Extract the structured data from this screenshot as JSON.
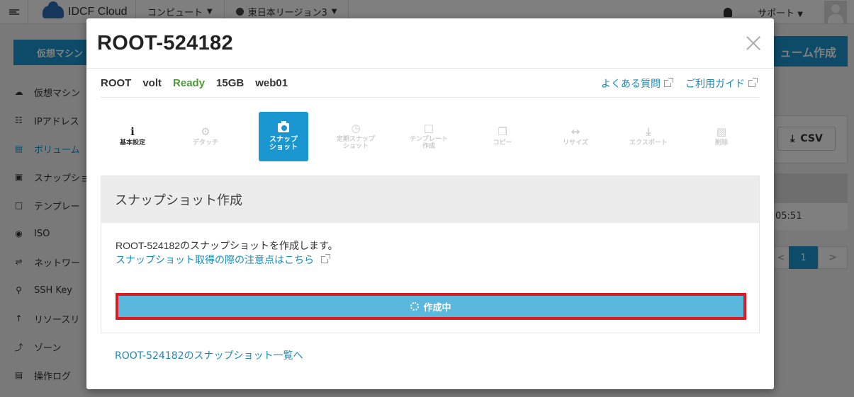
{
  "topbar": {
    "logo": "IDCF Cloud",
    "nav": [
      "コンピュート",
      "東日本リージョン3"
    ],
    "support": "サポート"
  },
  "sidebar": {
    "vm_button": "仮想マシン",
    "items": [
      {
        "label": "仮想マシン",
        "icon": "cloud-icon"
      },
      {
        "label": "IPアドレス",
        "icon": "network-icon"
      },
      {
        "label": "ボリューム",
        "icon": "database-icon",
        "active": true
      },
      {
        "label": "スナップショ",
        "icon": "camera-icon"
      },
      {
        "label": "テンプレー",
        "icon": "file-icon"
      },
      {
        "label": "ISO",
        "icon": "disc-icon"
      },
      {
        "label": "ネットワー",
        "icon": "shuffle-icon"
      },
      {
        "label": "SSH Key",
        "icon": "key-icon"
      },
      {
        "label": "リソースリ",
        "icon": "level-icon"
      },
      {
        "label": "ゾーン",
        "icon": "share-icon"
      },
      {
        "label": "操作ログ",
        "icon": "document-icon"
      }
    ]
  },
  "background": {
    "create_volume": "ューム作成",
    "csv": "CSV",
    "time": "05:51",
    "page_current": "1",
    "page_prev": "<",
    "page_next": ">"
  },
  "modal": {
    "title": "ROOT-524182",
    "info": {
      "type": "ROOT",
      "provider": "volt",
      "status": "Ready",
      "size": "15GB",
      "vm": "web01"
    },
    "help_links": [
      "よくある質問",
      "ご利用ガイド"
    ],
    "tiles": [
      {
        "label": "基本設定",
        "icon": "info-icon",
        "state": "enabled"
      },
      {
        "label": "デタッチ",
        "icon": "gear-icon",
        "state": "disabled"
      },
      {
        "label": "スナップ\nショット",
        "icon": "camera-icon",
        "state": "active"
      },
      {
        "label": "定期スナップ\nショット",
        "icon": "clock-icon",
        "state": "disabled"
      },
      {
        "label": "テンプレート\n作成",
        "icon": "file-icon",
        "state": "disabled"
      },
      {
        "label": "コピー",
        "icon": "copy-icon",
        "state": "disabled"
      },
      {
        "label": "リサイズ",
        "icon": "resize-icon",
        "state": "disabled"
      },
      {
        "label": "エクスポート",
        "icon": "download-icon",
        "state": "disabled"
      },
      {
        "label": "削除",
        "icon": "trash-icon",
        "state": "disabled"
      }
    ],
    "panel": {
      "title": "スナップショット作成",
      "description": "ROOT-524182のスナップショットを作成します。",
      "notice_link": "スナップショット取得の際の注意点はこちら",
      "progress_label": "作成中"
    },
    "list_link": "ROOT-524182のスナップショット一覧へ"
  },
  "colors": {
    "accent": "#1a96d0",
    "ready": "#4a9a34",
    "link": "#1a8ab8",
    "highlight_border": "#dd1a22",
    "progress_bg": "#5bb8dd"
  }
}
